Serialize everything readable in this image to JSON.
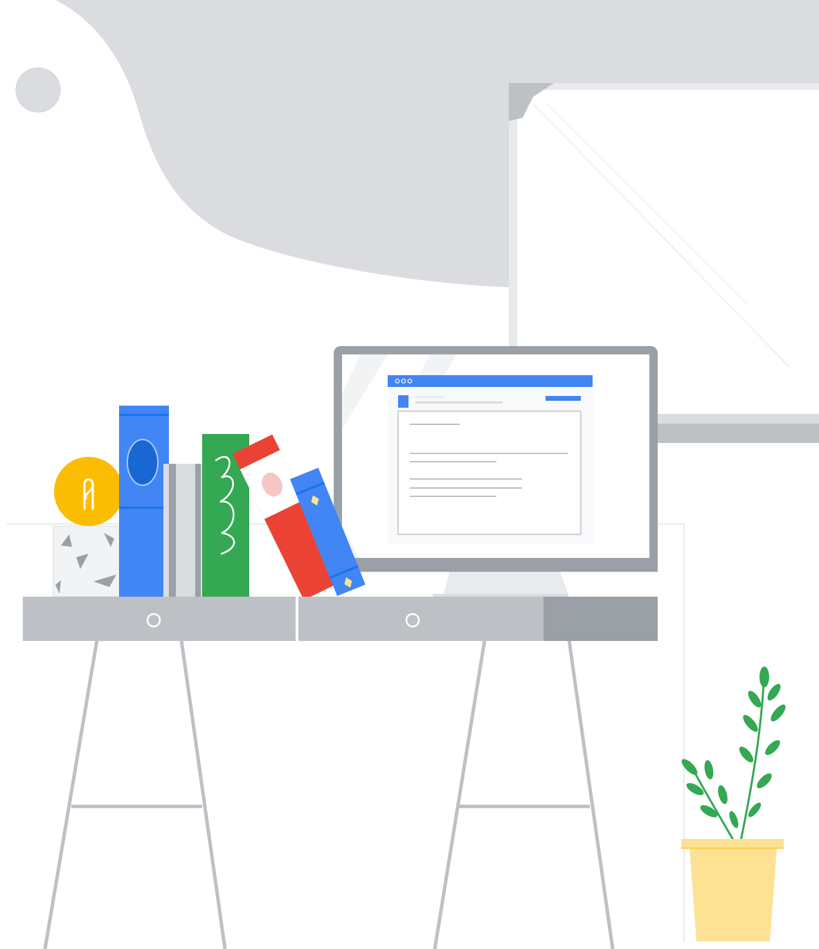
{
  "scene": {
    "description_labels": [],
    "browser_window": {
      "traffic_light_count": 3
    },
    "colors": {
      "background": "#ffffff",
      "wall_shape": "#dadce0",
      "accent_blue": "#4285f4",
      "accent_red": "#ea4335",
      "accent_green": "#34a853",
      "accent_yellow": "#fbbc04",
      "plant_pot": "#fde293",
      "desk_gray": "#bdc1c6",
      "monitor_frame": "#9aa0a6"
    }
  }
}
